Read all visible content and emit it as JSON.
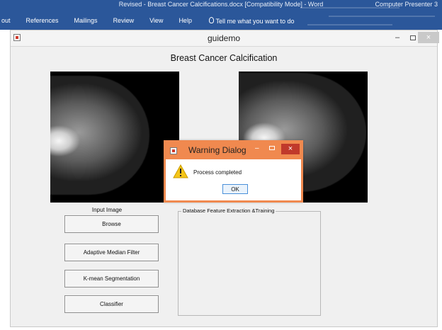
{
  "word": {
    "title": "Revised - Breast Cancer Calcifications.docx [Compatibility Mode]  -  Word",
    "account": "Computer Presenter 3",
    "menu": [
      "out",
      "References",
      "Mailings",
      "Review",
      "View",
      "Help"
    ],
    "tell_me": "Tell me what you want to do"
  },
  "window": {
    "title": "guidemo",
    "controls": {
      "minimize": "–",
      "close": "×"
    }
  },
  "gui": {
    "heading": "Breast Cancer Calcification",
    "input_label": "Input Image",
    "buttons": {
      "browse": "Browse",
      "adaptive_median_filter": "Adaptive Median Filter",
      "kmean": "K-mean Segmentation",
      "classifier": "Classifier"
    },
    "group_title": "Database Feature Extraction &Training"
  },
  "dialog": {
    "title": "Warning Dialog",
    "message": "Process completed",
    "ok_label": "OK",
    "controls": {
      "minimize": "–",
      "close": "×"
    },
    "accent": "#f0894f"
  },
  "icons": [
    "lightbulb-icon",
    "figure-window-icon",
    "warning-icon"
  ]
}
